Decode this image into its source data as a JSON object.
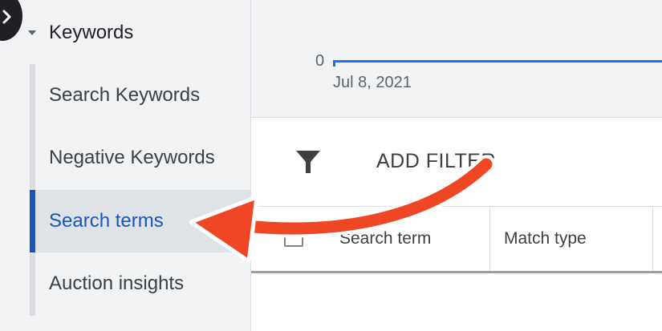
{
  "sidebar": {
    "section_label": "Keywords",
    "items": [
      {
        "label": "Search Keywords",
        "active": false
      },
      {
        "label": "Negative Keywords",
        "active": false
      },
      {
        "label": "Search terms",
        "active": true
      },
      {
        "label": "Auction insights",
        "active": false
      }
    ]
  },
  "chart": {
    "y_tick": "0",
    "x_tick": "Jul 8, 2021",
    "line_color": "#1a73e8"
  },
  "filter_bar": {
    "icon": "filter-icon",
    "add_filter_label": "ADD FILTER"
  },
  "table": {
    "columns": [
      "Search term",
      "Match type"
    ]
  },
  "colors": {
    "accent": "#1a56b8",
    "annotation_arrow": "#ef4723"
  }
}
